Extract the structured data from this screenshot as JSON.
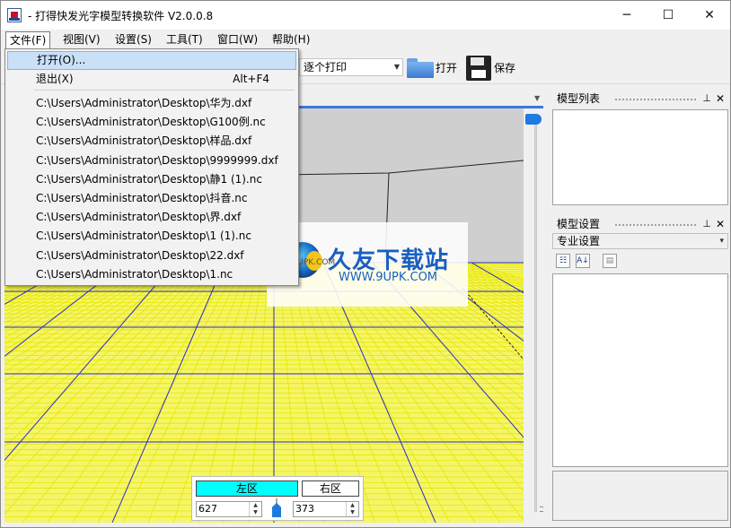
{
  "window": {
    "title": "- 打得快发光字模型转换软件 V2.0.0.8",
    "min_glyph": "─",
    "max_glyph": "☐",
    "close_glyph": "✕"
  },
  "menubar": {
    "items": [
      {
        "label": "文件(F)"
      },
      {
        "label": "视图(V)"
      },
      {
        "label": "设置(S)"
      },
      {
        "label": "工具(T)"
      },
      {
        "label": "窗口(W)"
      },
      {
        "label": "帮助(H)"
      }
    ]
  },
  "file_menu": {
    "open_label": "打开(O)...",
    "exit_label": "退出(X)",
    "exit_shortcut": "Alt+F4",
    "recent_files": [
      "C:\\Users\\Administrator\\Desktop\\华为.dxf",
      "C:\\Users\\Administrator\\Desktop\\G100例.nc",
      "C:\\Users\\Administrator\\Desktop\\样品.dxf",
      "C:\\Users\\Administrator\\Desktop\\9999999.dxf",
      "C:\\Users\\Administrator\\Desktop\\静1 (1).nc",
      "C:\\Users\\Administrator\\Desktop\\抖音.nc",
      "C:\\Users\\Administrator\\Desktop\\界.dxf",
      "C:\\Users\\Administrator\\Desktop\\1 (1).nc",
      "C:\\Users\\Administrator\\Desktop\\22.dxf",
      "C:\\Users\\Administrator\\Desktop\\1.nc"
    ]
  },
  "toolbar": {
    "print_mode": "逐个打印",
    "open_label": "打开",
    "save_label": "保存"
  },
  "panels": {
    "model_list_title": "模型列表",
    "model_settings_title": "模型设置",
    "settings_select": "专业设置",
    "pin_glyph": "📌",
    "close_glyph": "✕"
  },
  "zone": {
    "left_label": "左区",
    "right_label": "右区",
    "left_value": "627",
    "right_value": "373"
  },
  "watermark": {
    "brand": "久友下载站",
    "url": "WWW.9UPK.COM",
    "url_left": "WWW.9UPK.COM"
  },
  "colors": {
    "floor": "#f5f56a",
    "grid_yellow": "#e6e600",
    "grid_blue": "#2b2bd0",
    "accent": "#1e7ae0",
    "zone_active": "#00ffff"
  }
}
